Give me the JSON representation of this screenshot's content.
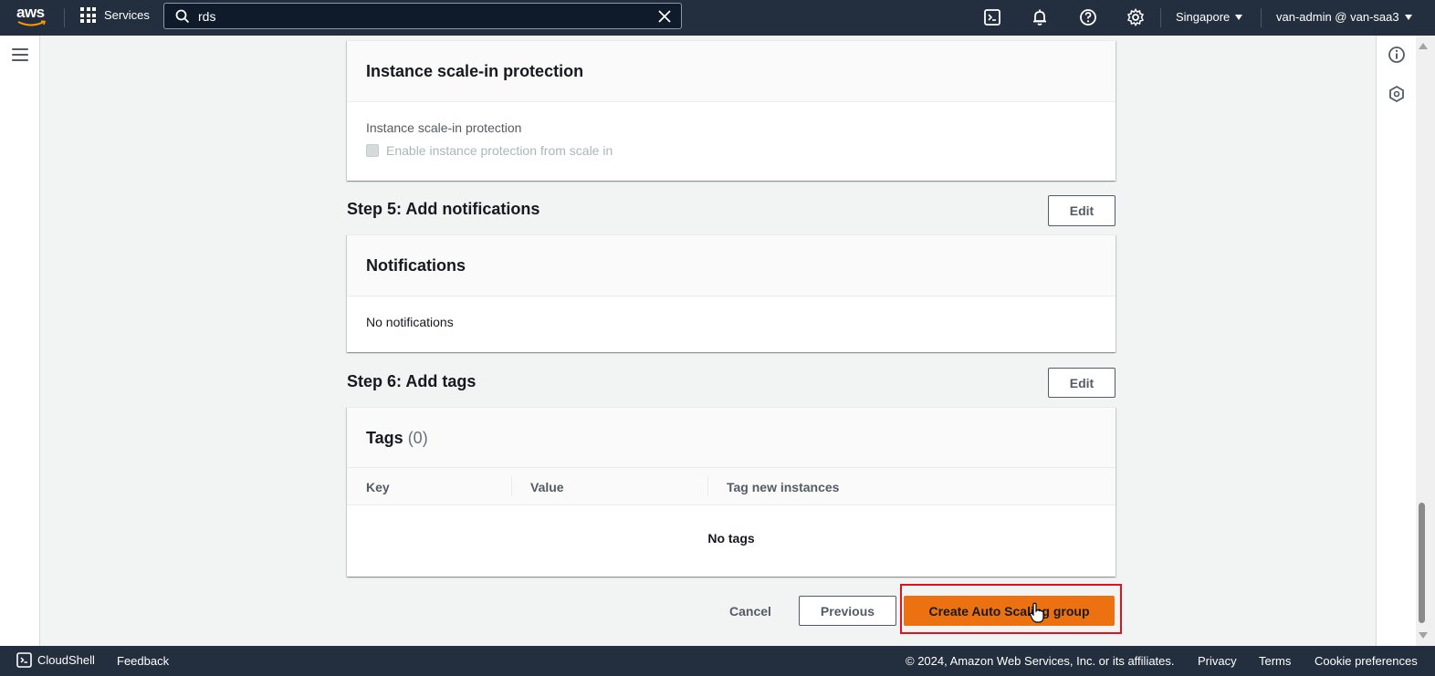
{
  "topnav": {
    "logo_text": "aws",
    "services_label": "Services",
    "search_value": "rds",
    "region_label": "Singapore",
    "account_label": "van-admin @ van-saa3"
  },
  "sections": {
    "scale_in": {
      "card_title": "Instance scale-in protection",
      "field_label": "Instance scale-in protection",
      "checkbox_label": "Enable instance protection from scale in",
      "checked": false
    },
    "step5": {
      "title": "Step 5: Add notifications",
      "edit_label": "Edit",
      "card_title": "Notifications",
      "body_text": "No notifications"
    },
    "step6": {
      "title": "Step 6: Add tags",
      "edit_label": "Edit",
      "card_title": "Tags",
      "count": "(0)",
      "columns": [
        "Key",
        "Value",
        "Tag new instances"
      ],
      "empty_text": "No tags"
    }
  },
  "actions": {
    "cancel_label": "Cancel",
    "previous_label": "Previous",
    "create_label": "Create Auto Scaling group"
  },
  "footer": {
    "cloudshell_label": "CloudShell",
    "feedback_label": "Feedback",
    "copyright": "© 2024, Amazon Web Services, Inc. or its affiliates.",
    "privacy_label": "Privacy",
    "terms_label": "Terms",
    "cookie_label": "Cookie preferences"
  },
  "colors": {
    "nav_bg": "#232f3e",
    "primary_button": "#ec7211",
    "highlight_border": "#e0121f"
  },
  "icons": [
    "aws-logo-icon",
    "services-grid-icon",
    "search-icon",
    "clear-icon",
    "cloudshell-icon",
    "notifications-bell-icon",
    "help-icon",
    "settings-gear-icon",
    "hamburger-menu-icon",
    "info-icon",
    "feedback-hex-icon",
    "cursor-hand-icon"
  ]
}
